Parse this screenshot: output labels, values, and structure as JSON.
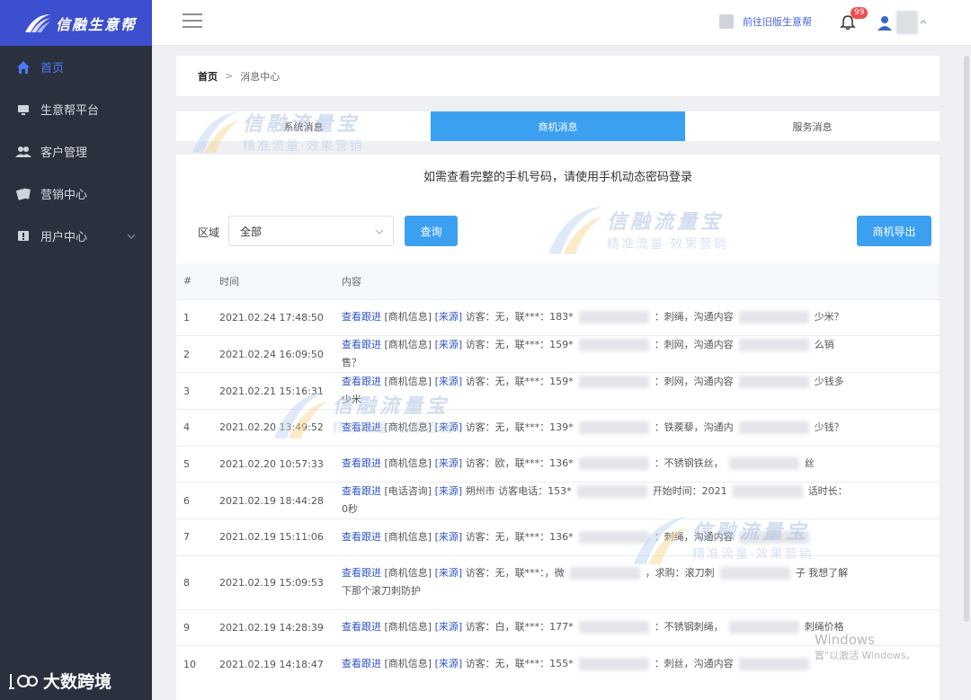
{
  "app": {
    "logo_text": "信融生意帮"
  },
  "sidebar": {
    "items": [
      {
        "label": "首页",
        "icon": "home-icon",
        "active": true
      },
      {
        "label": "生意帮平台",
        "icon": "monitor-icon"
      },
      {
        "label": "客户管理",
        "icon": "users-icon"
      },
      {
        "label": "营销中心",
        "icon": "cards-icon"
      },
      {
        "label": "用户中心",
        "icon": "flag-icon",
        "expandable": true
      }
    ]
  },
  "header": {
    "old_version_link": "前往旧版生意帮",
    "notification_count": "99"
  },
  "breadcrumb": {
    "home": "首页",
    "separator": ">",
    "current": "消息中心"
  },
  "tabs": [
    {
      "label": "系统消息"
    },
    {
      "label": "商机消息",
      "active": true
    },
    {
      "label": "服务消息"
    }
  ],
  "notice": "如需查看完整的手机号码，请使用手机动态密码登录",
  "filter": {
    "label": "区域",
    "selected": "全部",
    "query_button": "查询",
    "export_button": "商机导出"
  },
  "table": {
    "headers": [
      "#",
      "时间",
      "内容"
    ],
    "rows": [
      {
        "idx": "1",
        "time": "2021.02.24 17:48:50",
        "link": "查看跟进",
        "tag1": "[商机信息]",
        "tag2": "[来源]",
        "pre": "访客：无，联***：183*",
        "mid": "：刺绳，沟通内容",
        "post": "少米？"
      },
      {
        "idx": "2",
        "time": "2021.02.24 16:09:50",
        "link": "查看跟进",
        "tag1": "[商机信息]",
        "tag2": "[来源]",
        "pre": "访客：无，联***：159*",
        "mid": "：刺网，沟通内容",
        "post": "么销售？"
      },
      {
        "idx": "3",
        "time": "2021.02.21 15:16:31",
        "link": "查看跟进",
        "tag1": "[商机信息]",
        "tag2": "[来源]",
        "pre": "访客：无，联***：159*",
        "mid": "：刺网，沟通内容",
        "post": "少钱多少米"
      },
      {
        "idx": "4",
        "time": "2021.02.20 13:49:52",
        "link": "查看跟进",
        "tag1": "[商机信息]",
        "tag2": "[来源]",
        "pre": "访客：无，联***：139*",
        "mid": "：铁蒺藜，沟通内",
        "post": "少钱？"
      },
      {
        "idx": "5",
        "time": "2021.02.20 10:57:33",
        "link": "查看跟进",
        "tag1": "[商机信息]",
        "tag2": "[来源]",
        "pre": "访客：欧，联***：136*",
        "mid": "：不锈钢铁丝，",
        "post": "丝"
      },
      {
        "idx": "6",
        "time": "2021.02.19 18:44:28",
        "link": "查看跟进",
        "tag1": "[电话咨询]",
        "tag2": "[来源]",
        "pre": "朔州市 访客电话：153*",
        "mid": "开始时间：2021",
        "post": "话时长：0秒"
      },
      {
        "idx": "7",
        "time": "2021.02.19 15:11:06",
        "link": "查看跟进",
        "tag1": "[商机信息]",
        "tag2": "[来源]",
        "pre": "访客：无，联***：136*",
        "mid": "：刺绳，沟通内容",
        "post": ""
      },
      {
        "idx": "8",
        "time": "2021.02.19 15:09:53",
        "link": "查看跟进",
        "tag1": "[商机信息]",
        "tag2": "[来源]",
        "pre": "访客：无，联***：，微",
        "mid": "，求购：滚刀刺",
        "post": "子 我想了解下那个滚刀刺防护",
        "tall": true
      },
      {
        "idx": "9",
        "time": "2021.02.19 14:28:39",
        "link": "查看跟进",
        "tag1": "[商机信息]",
        "tag2": "[来源]",
        "pre": "访客：白，联***：177*",
        "mid": "：不锈钢刺绳，",
        "post": "刺绳价格"
      },
      {
        "idx": "10",
        "time": "2021.02.19 14:18:47",
        "link": "查看跟进",
        "tag1": "[商机信息]",
        "tag2": "[来源]",
        "pre": "访客：无，联***：155*",
        "mid": "：刺丝，沟通内容",
        "post": ""
      }
    ]
  },
  "watermark": {
    "title": "信融流量宝",
    "subtitle": "精准流量·效果营销"
  },
  "windows_watermark": {
    "line1": "Windows",
    "line2": "置\"以激活 Windows。"
  },
  "bottom_brand": "大数跨境",
  "colors": {
    "sidebar_bg": "#2b303e",
    "logo_bg": "#3c4fcf",
    "accent": "#3ca0f0",
    "link": "#2f54c9",
    "badge": "#ee4d4d"
  }
}
